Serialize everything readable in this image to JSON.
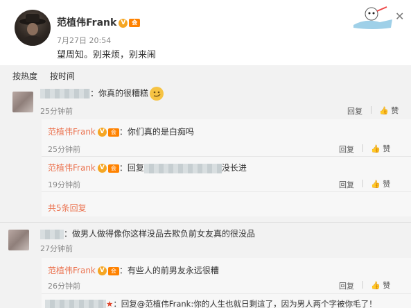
{
  "post": {
    "author": "范植伟Frank",
    "verified_glyph": "V",
    "vip_glyph": "会",
    "time": "7月27日 20:54",
    "text": "望周知。别来烦，别来闹"
  },
  "tabs": [
    "按热度",
    "按时间"
  ],
  "actions": {
    "reply": "回复",
    "like": "赞"
  },
  "comments": [
    {
      "text": "：你真的很糟糕",
      "time": "25分钟前",
      "replies": [
        {
          "author": "范植伟Frank",
          "text": "：你们真的是白痴吗",
          "time": "25分钟前"
        },
        {
          "author": "范植伟Frank",
          "text_prefix": "：回复",
          "text_suffix": "没长进",
          "time": "19分钟前"
        }
      ],
      "more": "共5条回复"
    },
    {
      "text": "：做男人做得像你这样没品去欺负前女友真的很没品",
      "time": "27分钟前",
      "replies": [
        {
          "author": "范植伟Frank",
          "text": "：有些人的前男友永远很糟",
          "time": "26分钟前"
        },
        {
          "text": "：回复@范植伟Frank:你的人生也就日剩這了，因为男人两个字被你毛了！"
        }
      ]
    }
  ],
  "icons": {
    "verified": "verified-icon",
    "vip": "vip-icon",
    "like": "thumbs-up-icon",
    "close": "close-icon",
    "emoji": "smirk-emoji-icon"
  },
  "colors": {
    "accent": "#eb7350",
    "badge": "#f5a623",
    "background": "#f2f2f2"
  }
}
